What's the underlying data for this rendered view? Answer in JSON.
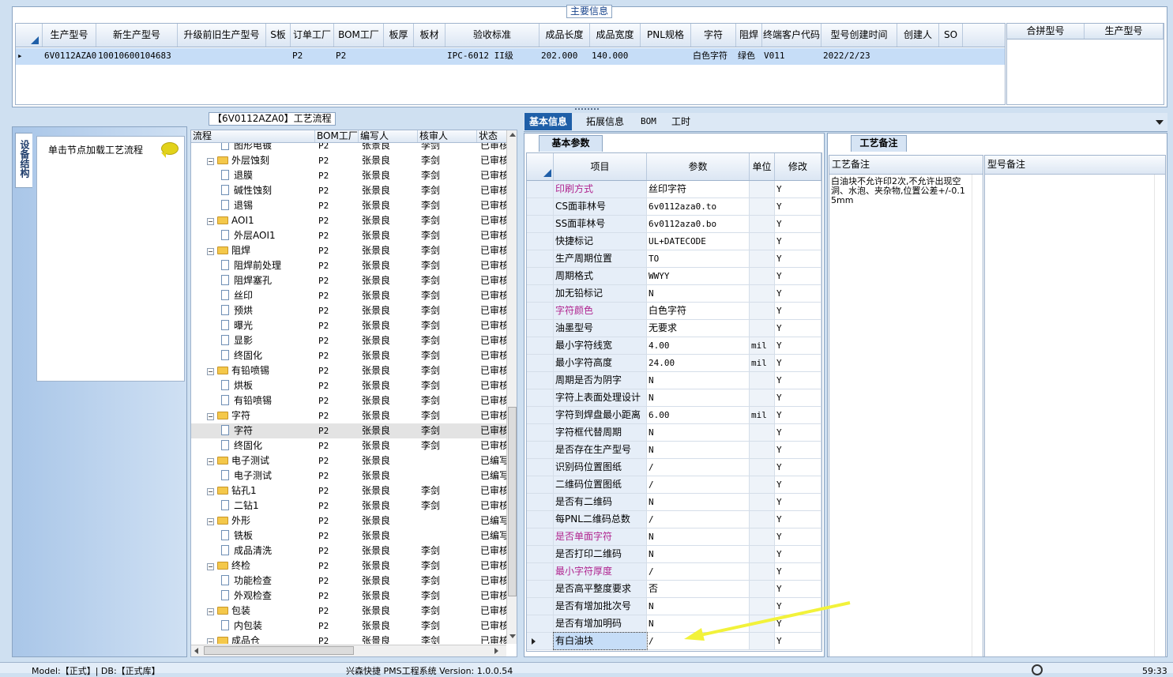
{
  "main_info": {
    "title": "主要信息",
    "columns": [
      "生产型号",
      "新生产型号",
      "升级前旧生产型号",
      "S板",
      "订单工厂",
      "BOM工厂",
      "板厚",
      "板材",
      "验收标准",
      "成品长度",
      "成品宽度",
      "PNL规格",
      "字符",
      "阻焊",
      "终端客户代码",
      "型号创建时间",
      "创建人",
      "SO"
    ],
    "row": {
      "pointer": "▸",
      "model": "6V0112AZA0",
      "new_model": "10010600104683",
      "old_model": "",
      "s_board": "",
      "order_factory": "P2",
      "bom_factory": "P2",
      "thickness": "",
      "material": "",
      "standard": "IPC-6012 II级",
      "length": "202.000",
      "width": "140.000",
      "pnl": "",
      "char": "白色字符",
      "solder": "绿色",
      "customer": "V011",
      "created": "2022/2/23",
      "creator": "",
      "so": ""
    },
    "merge_columns": [
      "合拼型号",
      "生产型号"
    ]
  },
  "flow_title": "【6V0112AZA0】工艺流程",
  "side_tab": "设备结构",
  "load_hint": "单击节点加载工艺流程",
  "tree": {
    "columns": [
      "流程",
      "BOM工厂",
      "编写人",
      "核审人",
      "状态"
    ],
    "rows": [
      {
        "level": 2,
        "name": "图形电镀",
        "f": "P2",
        "w": "张景良",
        "r": "李剑",
        "s": "已审核"
      },
      {
        "level": 1,
        "name": "外层蚀刻",
        "f": "P2",
        "w": "张景良",
        "r": "李剑",
        "s": "已审核"
      },
      {
        "level": 2,
        "name": "退膜",
        "f": "P2",
        "w": "张景良",
        "r": "李剑",
        "s": "已审核"
      },
      {
        "level": 2,
        "name": "碱性蚀刻",
        "f": "P2",
        "w": "张景良",
        "r": "李剑",
        "s": "已审核"
      },
      {
        "level": 2,
        "name": "退锡",
        "f": "P2",
        "w": "张景良",
        "r": "李剑",
        "s": "已审核"
      },
      {
        "level": 1,
        "name": "AOI1",
        "f": "P2",
        "w": "张景良",
        "r": "李剑",
        "s": "已审核"
      },
      {
        "level": 2,
        "name": "外层AOI1",
        "f": "P2",
        "w": "张景良",
        "r": "李剑",
        "s": "已审核"
      },
      {
        "level": 1,
        "name": "阻焊",
        "f": "P2",
        "w": "张景良",
        "r": "李剑",
        "s": "已审核"
      },
      {
        "level": 2,
        "name": "阻焊前处理",
        "f": "P2",
        "w": "张景良",
        "r": "李剑",
        "s": "已审核"
      },
      {
        "level": 2,
        "name": "阻焊塞孔",
        "f": "P2",
        "w": "张景良",
        "r": "李剑",
        "s": "已审核"
      },
      {
        "level": 2,
        "name": "丝印",
        "f": "P2",
        "w": "张景良",
        "r": "李剑",
        "s": "已审核"
      },
      {
        "level": 2,
        "name": "预烘",
        "f": "P2",
        "w": "张景良",
        "r": "李剑",
        "s": "已审核"
      },
      {
        "level": 2,
        "name": "曝光",
        "f": "P2",
        "w": "张景良",
        "r": "李剑",
        "s": "已审核"
      },
      {
        "level": 2,
        "name": "显影",
        "f": "P2",
        "w": "张景良",
        "r": "李剑",
        "s": "已审核"
      },
      {
        "level": 2,
        "name": "终固化",
        "f": "P2",
        "w": "张景良",
        "r": "李剑",
        "s": "已审核"
      },
      {
        "level": 1,
        "name": "有铅喷锡",
        "f": "P2",
        "w": "张景良",
        "r": "李剑",
        "s": "已审核"
      },
      {
        "level": 2,
        "name": "烘板",
        "f": "P2",
        "w": "张景良",
        "r": "李剑",
        "s": "已审核"
      },
      {
        "level": 2,
        "name": "有铅喷锡",
        "f": "P2",
        "w": "张景良",
        "r": "李剑",
        "s": "已审核"
      },
      {
        "level": 1,
        "name": "字符",
        "f": "P2",
        "w": "张景良",
        "r": "李剑",
        "s": "已审核"
      },
      {
        "level": 2,
        "name": "字符",
        "f": "P2",
        "w": "张景良",
        "r": "李剑",
        "s": "已审核",
        "selected": true
      },
      {
        "level": 2,
        "name": "终固化",
        "f": "P2",
        "w": "张景良",
        "r": "李剑",
        "s": "已审核"
      },
      {
        "level": 1,
        "name": "电子测试",
        "f": "P2",
        "w": "张景良",
        "r": "",
        "s": "已编写"
      },
      {
        "level": 2,
        "name": "电子测试",
        "f": "P2",
        "w": "张景良",
        "r": "",
        "s": "已编写"
      },
      {
        "level": 1,
        "name": "钻孔1",
        "f": "P2",
        "w": "张景良",
        "r": "李剑",
        "s": "已审核"
      },
      {
        "level": 2,
        "name": "二钻1",
        "f": "P2",
        "w": "张景良",
        "r": "李剑",
        "s": "已审核"
      },
      {
        "level": 1,
        "name": "外形",
        "f": "P2",
        "w": "张景良",
        "r": "",
        "s": "已编写"
      },
      {
        "level": 2,
        "name": "铣板",
        "f": "P2",
        "w": "张景良",
        "r": "",
        "s": "已编写"
      },
      {
        "level": 2,
        "name": "成品清洗",
        "f": "P2",
        "w": "张景良",
        "r": "李剑",
        "s": "已审核"
      },
      {
        "level": 1,
        "name": "终检",
        "f": "P2",
        "w": "张景良",
        "r": "李剑",
        "s": "已审核"
      },
      {
        "level": 2,
        "name": "功能检查",
        "f": "P2",
        "w": "张景良",
        "r": "李剑",
        "s": "已审核"
      },
      {
        "level": 2,
        "name": "外观检查",
        "f": "P2",
        "w": "张景良",
        "r": "李剑",
        "s": "已审核"
      },
      {
        "level": 1,
        "name": "包装",
        "f": "P2",
        "w": "张景良",
        "r": "李剑",
        "s": "已审核"
      },
      {
        "level": 2,
        "name": "内包装",
        "f": "P2",
        "w": "张景良",
        "r": "李剑",
        "s": "已审核"
      },
      {
        "level": 1,
        "name": "成品仓",
        "f": "P2",
        "w": "张景良",
        "r": "李剑",
        "s": "已审核"
      }
    ]
  },
  "right_tabs": [
    "基本信息",
    "拓展信息",
    "BOM",
    "工时"
  ],
  "param_tab": "基本参数",
  "params": {
    "columns": [
      "项目",
      "参数",
      "单位",
      "修改"
    ],
    "rows": [
      {
        "item": "印刷方式",
        "val": "丝印字符",
        "unit": "",
        "mod": "Y",
        "pink": true
      },
      {
        "item": "CS面菲林号",
        "val": "6v0112aza0.to",
        "unit": "",
        "mod": "Y"
      },
      {
        "item": "SS面菲林号",
        "val": "6v0112aza0.bo",
        "unit": "",
        "mod": "Y"
      },
      {
        "item": "快捷标记",
        "val": "UL+DATECODE",
        "unit": "",
        "mod": "Y"
      },
      {
        "item": "生产周期位置",
        "val": "TO",
        "unit": "",
        "mod": "Y"
      },
      {
        "item": "周期格式",
        "val": "WWYY",
        "unit": "",
        "mod": "Y"
      },
      {
        "item": "加无铅标记",
        "val": "N",
        "unit": "",
        "mod": "Y"
      },
      {
        "item": "字符颜色",
        "val": "白色字符",
        "unit": "",
        "mod": "Y",
        "pink": true
      },
      {
        "item": "油墨型号",
        "val": "无要求",
        "unit": "",
        "mod": "Y"
      },
      {
        "item": "最小字符线宽",
        "val": "4.00",
        "unit": "mil",
        "mod": "Y"
      },
      {
        "item": "最小字符高度",
        "val": "24.00",
        "unit": "mil",
        "mod": "Y"
      },
      {
        "item": "周期是否为阴字",
        "val": "N",
        "unit": "",
        "mod": "Y"
      },
      {
        "item": "字符上表面处理设计",
        "val": "N",
        "unit": "",
        "mod": "Y"
      },
      {
        "item": "字符到焊盘最小距离",
        "val": "6.00",
        "unit": "mil",
        "mod": "Y"
      },
      {
        "item": "字符框代替周期",
        "val": "N",
        "unit": "",
        "mod": "Y"
      },
      {
        "item": "是否存在生产型号",
        "val": "N",
        "unit": "",
        "mod": "Y"
      },
      {
        "item": "识别码位置图纸",
        "val": "/",
        "unit": "",
        "mod": "Y"
      },
      {
        "item": "二维码位置图纸",
        "val": "/",
        "unit": "",
        "mod": "Y"
      },
      {
        "item": "是否有二维码",
        "val": "N",
        "unit": "",
        "mod": "Y"
      },
      {
        "item": "每PNL二维码总数",
        "val": "/",
        "unit": "",
        "mod": "Y"
      },
      {
        "item": "是否单面字符",
        "val": "N",
        "unit": "",
        "mod": "Y",
        "pink": true
      },
      {
        "item": "是否打印二维码",
        "val": "N",
        "unit": "",
        "mod": "Y"
      },
      {
        "item": "最小字符厚度",
        "val": "/",
        "unit": "",
        "mod": "Y",
        "pink": true
      },
      {
        "item": "是否高平整度要求",
        "val": "否",
        "unit": "",
        "mod": "Y"
      },
      {
        "item": "是否有增加批次号",
        "val": "N",
        "unit": "",
        "mod": "Y"
      },
      {
        "item": "是否有增加明码",
        "val": "N",
        "unit": "",
        "mod": "Y"
      },
      {
        "item": "有白油块",
        "val": "/",
        "unit": "",
        "mod": "Y",
        "current": true
      }
    ]
  },
  "process_tab": "工艺备注",
  "notes": {
    "process_label": "工艺备注",
    "model_label": "型号备注",
    "process_text": "白油块不允许印2次,不允许出现空洞、水泡、夹杂物,位置公差+/-0.15mm"
  },
  "status": {
    "left": "Model:【正式】| DB:【正式库】",
    "center": "兴森快捷 PMS工程系统 Version: 1.0.0.54",
    "time": "59:33"
  },
  "colors": {
    "selection": "#c6ddf7",
    "accent": "#1f5fa8",
    "pink": "#b0248f",
    "arrow": "#f2f23a"
  }
}
